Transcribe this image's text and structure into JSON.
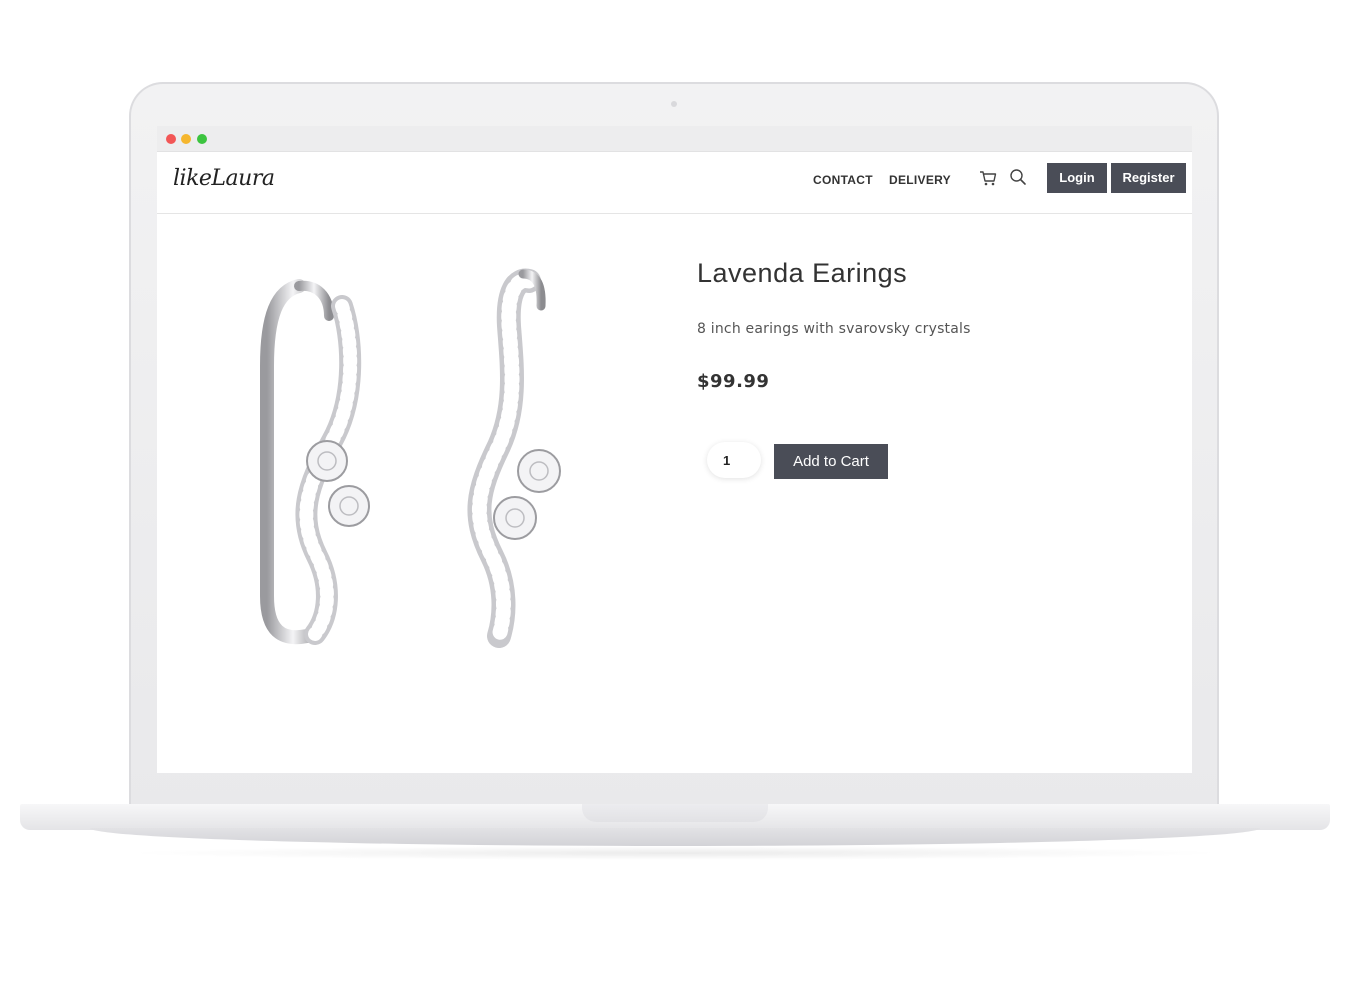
{
  "site": {
    "logo_text": "likeLaura",
    "nav": {
      "contact": "CONTACT",
      "delivery": "DELIVERY",
      "login": "Login",
      "register": "Register"
    }
  },
  "product": {
    "title": "Lavenda Earings",
    "description": "8 inch earings with svarovsky crystals",
    "price": "$99.99",
    "quantity": "1",
    "add_to_cart_label": "Add to Cart"
  },
  "colors": {
    "button_bg": "#4a4d57",
    "window_close": "#f25656",
    "window_minimize": "#f5b62e",
    "window_maximize": "#3cc43f"
  },
  "icons": [
    "cart-icon",
    "search-icon"
  ]
}
